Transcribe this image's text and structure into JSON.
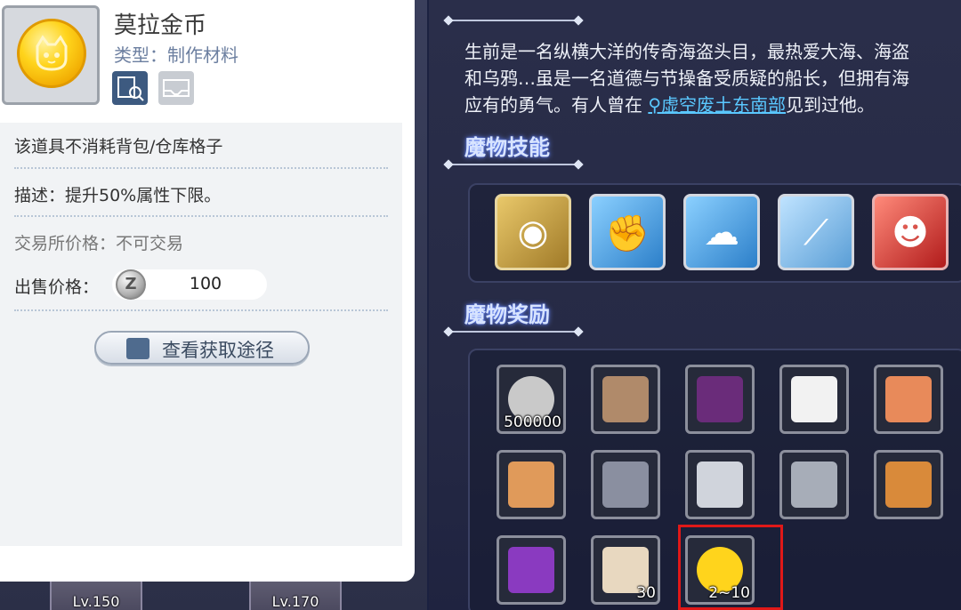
{
  "item": {
    "name": "莫拉金币",
    "type": "类型：制作材料",
    "no_slot": "该道具不消耗背包/仓库格子",
    "description": "描述：提升50%属性下限。",
    "exchange": "交易所价格：不可交易",
    "sell_label": "出售价格：",
    "sell_icon": "Z",
    "sell_value": "100",
    "route_button": "查看获取途径"
  },
  "background": {
    "levels": [
      "Lv.150",
      "Lv.170"
    ]
  },
  "monster": {
    "desc_line1": "生前是一名纵横大洋的传奇海盗头目，最热爱大海、海盗",
    "desc_line2": "和乌鸦…虽是一名道德与节操备受质疑的船长，但拥有海",
    "desc_line3_a": "应有的勇气。有人曾在 ",
    "desc_location": "虚空废土东南部",
    "desc_line3_b": "见到过他。",
    "skills_title": "魔物技能",
    "rewards_title": "魔物奖励",
    "skills": [
      {
        "icon": "orb-icon",
        "color": "gold",
        "glyph": "◉"
      },
      {
        "icon": "fist-icon",
        "color": "blue",
        "glyph": "✊"
      },
      {
        "icon": "ghost-icon",
        "color": "blue",
        "glyph": "☁"
      },
      {
        "icon": "shatter-icon",
        "color": "lblue",
        "glyph": "⟋"
      },
      {
        "icon": "rage-icon",
        "color": "red",
        "glyph": "☻"
      }
    ],
    "rewards": [
      {
        "icon": "zeny-coin-icon",
        "qty": "500000",
        "color": "#c9c9c9"
      },
      {
        "icon": "scroll-icon",
        "qty": "",
        "color": "#b08a6a"
      },
      {
        "icon": "pirate-hat-icon",
        "qty": "",
        "color": "#6a2c7a"
      },
      {
        "icon": "paper-icon",
        "qty": "",
        "color": "#f2f2f2"
      },
      {
        "icon": "crystal-icon",
        "qty": "",
        "color": "#e88a5a"
      },
      {
        "icon": "puzzle-icon",
        "qty": "",
        "color": "#e09a5a"
      },
      {
        "icon": "feather-icon",
        "qty": "",
        "color": "#8a8fa0"
      },
      {
        "icon": "sword-icon",
        "qty": "",
        "color": "#d0d4dc"
      },
      {
        "icon": "spear-icon",
        "qty": "",
        "color": "#a7adb8"
      },
      {
        "icon": "staff-icon",
        "qty": "",
        "color": "#d98a3a"
      },
      {
        "icon": "shuriken-icon",
        "qty": "",
        "color": "#8a3ac0"
      },
      {
        "icon": "bone-icon",
        "qty": "30",
        "color": "#e8d8c0"
      },
      {
        "icon": "mora-coin-icon",
        "qty": "2~10",
        "color": "#ffd41c"
      }
    ]
  }
}
